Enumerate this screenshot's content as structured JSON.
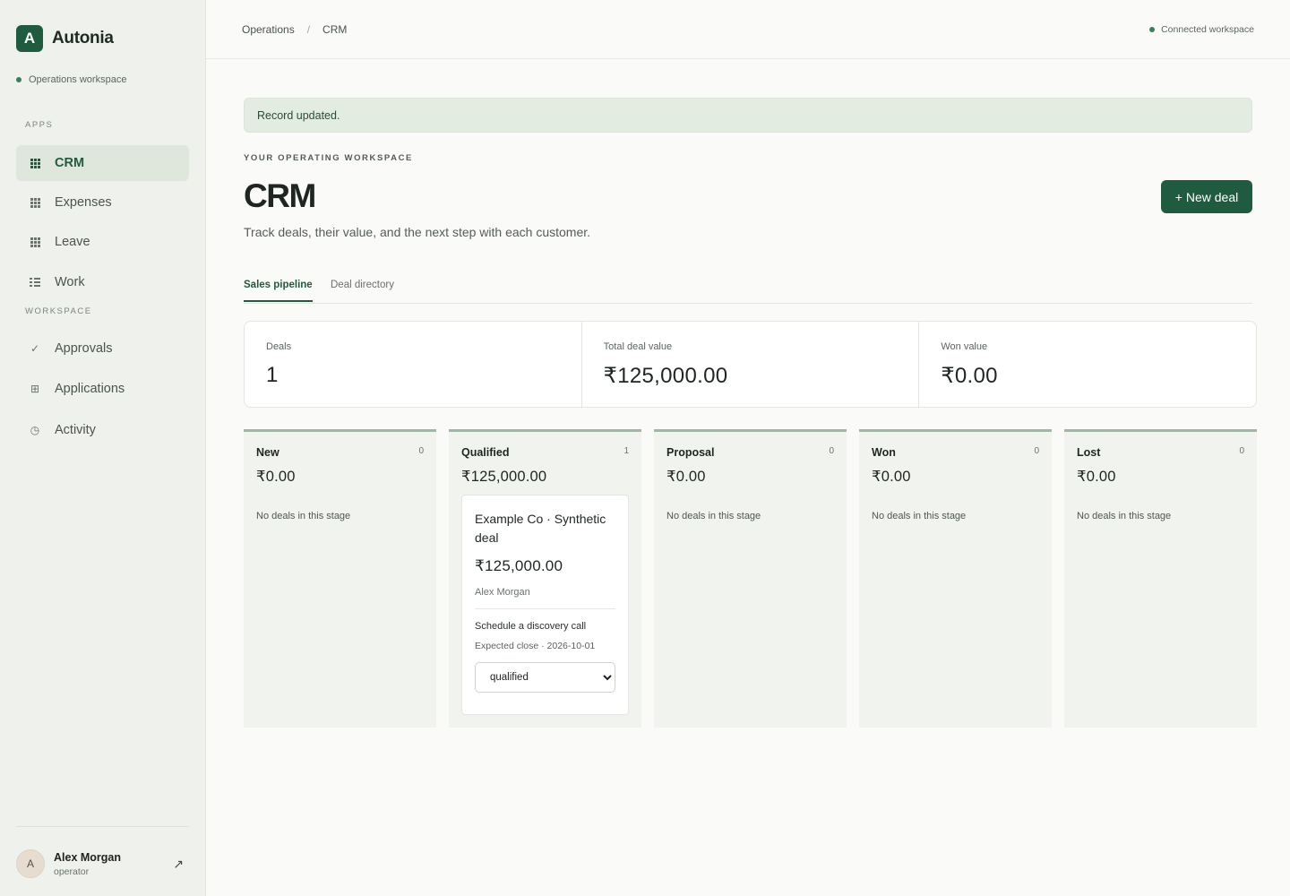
{
  "brand": {
    "logo_letter": "A",
    "name": "Autonia"
  },
  "workspace_status": "Operations workspace",
  "sidebar": {
    "apps_label": "APPS",
    "workspace_label": "WORKSPACE",
    "apps": [
      {
        "label": "CRM",
        "icon": "grid-icon",
        "active": true
      },
      {
        "label": "Expenses",
        "icon": "grid-icon"
      },
      {
        "label": "Leave",
        "icon": "grid-icon"
      },
      {
        "label": "Work",
        "icon": "list-icon"
      }
    ],
    "workspace": [
      {
        "label": "Approvals",
        "icon": "check-icon"
      },
      {
        "label": "Applications",
        "icon": "apps-icon"
      },
      {
        "label": "Activity",
        "icon": "clock-icon"
      }
    ]
  },
  "user": {
    "initial": "A",
    "name": "Alex Morgan",
    "role": "operator"
  },
  "topbar": {
    "breadcrumb": [
      "Operations",
      "CRM"
    ],
    "separator": "/",
    "connection": "Connected workspace"
  },
  "alert": "Record updated.",
  "page": {
    "eyebrow": "YOUR OPERATING WORKSPACE",
    "title": "CRM",
    "description": "Track deals, their value, and the next step with each customer.",
    "new_deal_label": "+ New deal"
  },
  "tabs": [
    {
      "label": "Sales pipeline",
      "active": true
    },
    {
      "label": "Deal directory"
    }
  ],
  "stats": [
    {
      "label": "Deals",
      "value": "1"
    },
    {
      "label": "Total deal value",
      "value": "₹125,000.00"
    },
    {
      "label": "Won value",
      "value": "₹0.00"
    }
  ],
  "columns": [
    {
      "name": "New",
      "count": "0",
      "value": "₹0.00",
      "empty": "No deals in this stage"
    },
    {
      "name": "Qualified",
      "count": "1",
      "value": "₹125,000.00",
      "empty": ""
    },
    {
      "name": "Proposal",
      "count": "0",
      "value": "₹0.00",
      "empty": "No deals in this stage"
    },
    {
      "name": "Won",
      "count": "0",
      "value": "₹0.00",
      "empty": "No deals in this stage"
    },
    {
      "name": "Lost",
      "count": "0",
      "value": "₹0.00",
      "empty": "No deals in this stage"
    }
  ],
  "deal": {
    "title": "Example Co · Synthetic deal",
    "value": "₹125,000.00",
    "owner": "Alex Morgan",
    "next_step": "Schedule a discovery call",
    "expected_close": "Expected close · 2026-10-01",
    "stage": "qualified"
  },
  "colors": {
    "accent": "#1f5c3f",
    "sidebar_bg": "#eef1ec",
    "alert_bg": "#e3ece0",
    "column_top": "#9db8a3"
  }
}
